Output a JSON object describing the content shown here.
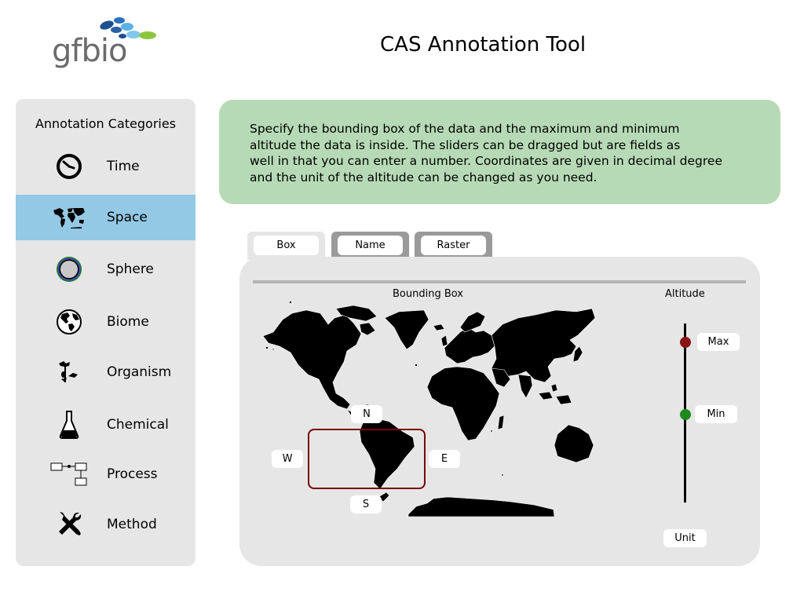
{
  "header": {
    "logo_text": "gfbio",
    "title": "CAS Annotation Tool"
  },
  "sidebar": {
    "heading": "Annotation Categories",
    "active_item": "Space",
    "items": [
      {
        "label": "Time",
        "icon": "clock-icon"
      },
      {
        "label": "Space",
        "icon": "world-map-icon"
      },
      {
        "label": "Sphere",
        "icon": "sphere-icon"
      },
      {
        "label": "Biome",
        "icon": "globe-icon"
      },
      {
        "label": "Organism",
        "icon": "organism-icon"
      },
      {
        "label": "Chemical",
        "icon": "flask-icon"
      },
      {
        "label": "Process",
        "icon": "process-diagram-icon"
      },
      {
        "label": "Method",
        "icon": "tools-icon"
      }
    ]
  },
  "info": {
    "line1": "Specify the bounding box of the data and the maximum and minimum",
    "line2": "altitude the data is inside. The sliders can be dragged but are fields as",
    "line3": "well in that you can enter a number. Coordinates are given in decimal degree",
    "line4": "and the unit of the altitude can be changed as you need."
  },
  "tabs": {
    "active": "Box",
    "items": [
      {
        "label": "Box"
      },
      {
        "label": "Name"
      },
      {
        "label": "Raster"
      }
    ]
  },
  "bounding_box": {
    "label": "Bounding Box",
    "north": "N",
    "south": "S",
    "west": "W",
    "east": "E"
  },
  "altitude": {
    "label": "Altitude",
    "max": "Max",
    "min": "Min",
    "unit": "Unit"
  },
  "colors": {
    "sidebar_bg": "#e6e6e6",
    "active_item": "#93c9e5",
    "info_bg": "#b7dab6",
    "bbox_border": "#7a0000",
    "max_handle": "#8b1414",
    "min_handle": "#1e8a1e"
  }
}
